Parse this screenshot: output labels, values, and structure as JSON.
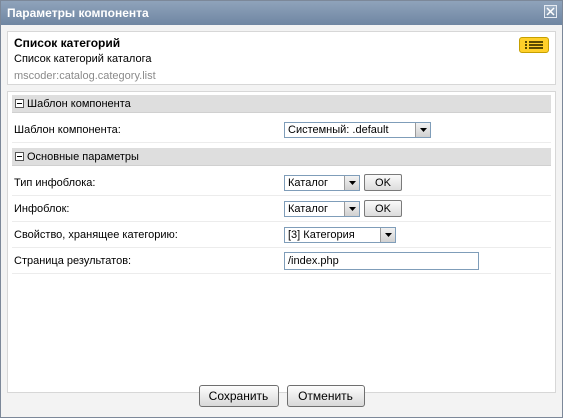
{
  "window": {
    "title": "Параметры компонента"
  },
  "component": {
    "name": "Список категорий",
    "description": "Список категорий каталога",
    "code": "mscoder:catalog.category.list"
  },
  "sections": [
    {
      "title": "Шаблон компонента"
    },
    {
      "title": "Основные параметры"
    }
  ],
  "template_row": {
    "label": "Шаблон компонента:",
    "value": "Системный: .default"
  },
  "params": {
    "iblock_type": {
      "label": "Тип инфоблока:",
      "value": "Каталог",
      "button": "OK"
    },
    "iblock": {
      "label": "Инфоблок:",
      "value": "Каталог",
      "button": "OK"
    },
    "category_prop": {
      "label": "Свойство, хранящее категорию:",
      "value": "[3] Категория"
    },
    "result_page": {
      "label": "Страница результатов:",
      "value": "/index.php"
    }
  },
  "footer": {
    "save": "Сохранить",
    "cancel": "Отменить"
  },
  "icons": {
    "close": "close-icon",
    "help": "list-icon"
  },
  "colors": {
    "titlebar": "#7a90aa",
    "section_bg": "#dedede",
    "help_icon": "#ffd02a"
  }
}
